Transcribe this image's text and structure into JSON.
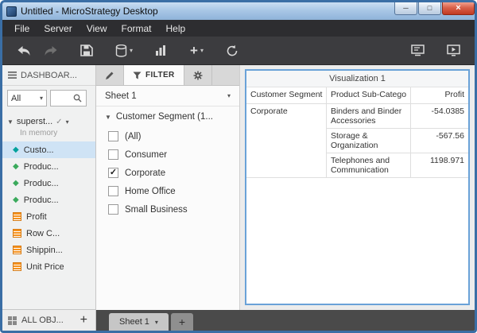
{
  "window": {
    "title": "Untitled - MicroStrategy Desktop"
  },
  "icons": {
    "minimize": "─",
    "maximize": "□",
    "close": "×",
    "caret_down": "▾",
    "tree_collapse": "▼",
    "check": "✓",
    "plus": "+"
  },
  "menu": {
    "items": [
      "File",
      "Server",
      "View",
      "Format",
      "Help"
    ]
  },
  "toolbar": {
    "buttons": [
      "back",
      "forward",
      "save",
      "add-dataset",
      "insert-visualization",
      "insert",
      "refresh",
      "slideshow",
      "presentation"
    ]
  },
  "sidebar": {
    "header": "DASHBOAR...",
    "filter_dropdown_value": "All",
    "dataset": {
      "label": "superst...",
      "status": "In memory"
    },
    "fields": [
      {
        "label": "Custo...",
        "type": "attribute",
        "selected": true
      },
      {
        "label": "Produc...",
        "type": "attribute"
      },
      {
        "label": "Produc...",
        "type": "attribute"
      },
      {
        "label": "Produc...",
        "type": "attribute"
      },
      {
        "label": "Profit",
        "type": "metric"
      },
      {
        "label": "Row C...",
        "type": "metric"
      },
      {
        "label": "Shippin...",
        "type": "metric"
      },
      {
        "label": "Unit Price",
        "type": "metric"
      }
    ],
    "footer": {
      "label": "ALL OBJ..."
    }
  },
  "filter_panel": {
    "tab_label": "FILTER",
    "sheet_label": "Sheet 1",
    "group_label": "Customer Segment (1...",
    "options": [
      {
        "label": "(All)",
        "checked": false
      },
      {
        "label": "Consumer",
        "checked": false
      },
      {
        "label": "Corporate",
        "checked": true
      },
      {
        "label": "Home Office",
        "checked": false
      },
      {
        "label": "Small Business",
        "checked": false
      }
    ]
  },
  "visualization": {
    "title": "Visualization 1",
    "table": {
      "columns": [
        "Customer Segment",
        "Product Sub-Catego",
        "Profit"
      ],
      "rows": [
        {
          "segment": "Corporate",
          "category": "Binders and Binder Accessories",
          "profit": "-54.0385"
        },
        {
          "category": "Storage & Organization",
          "profit": "-567.56"
        },
        {
          "category": "Telephones and Communication",
          "profit": "1198.971"
        }
      ]
    }
  },
  "sheet_bar": {
    "active_sheet": "Sheet 1"
  },
  "colors": {
    "selection_border": "#6aa2d8",
    "attribute_icon_teal": "#00a19c",
    "attribute_icon_green": "#3aaa5c",
    "metric_icon": "#f6921e",
    "selected_item_bg": "#cfe3f5",
    "close_button": "#c03a22"
  }
}
